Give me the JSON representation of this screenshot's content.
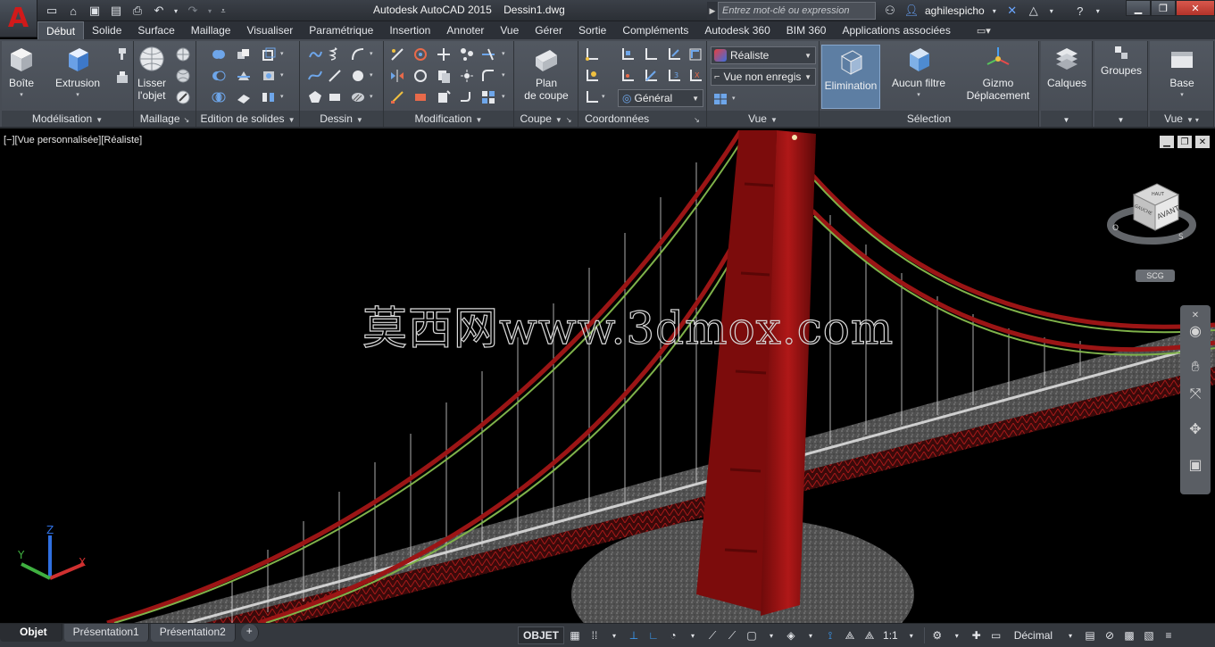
{
  "titlebar": {
    "app_name": "Autodesk AutoCAD 2015",
    "document_name": "Dessin1.dwg",
    "search_placeholder": "Entrez mot-clé ou expression",
    "username": "aghilespicho",
    "app_logo": "A"
  },
  "ribbon_tabs": [
    "Début",
    "Solide",
    "Surface",
    "Maillage",
    "Visualiser",
    "Paramétrique",
    "Insertion",
    "Annoter",
    "Vue",
    "Gérer",
    "Sortie",
    "Compléments",
    "Autodesk 360",
    "BIM 360",
    "Applications associées"
  ],
  "ribbon": {
    "modelisation": {
      "title": "Modélisation",
      "boite": "Boîte",
      "extrusion": "Extrusion"
    },
    "maillage": {
      "title": "Maillage",
      "lisser_1": "Lisser",
      "lisser_2": "l'objet"
    },
    "edition": {
      "title": "Edition de solides"
    },
    "dessin": {
      "title": "Dessin"
    },
    "modification": {
      "title": "Modification"
    },
    "coupe": {
      "title": "Coupe",
      "plan_1": "Plan",
      "plan_2": "de coupe"
    },
    "coordonnees": {
      "title": "Coordonnées",
      "ucs_value": "Général"
    },
    "vue": {
      "title": "Vue",
      "visual_style": "Réaliste",
      "named_view": "Vue non enregis"
    },
    "selection": {
      "title": "Sélection",
      "elimination": "Elimination",
      "filtre": "Aucun filtre",
      "gizmo_1": "Gizmo",
      "gizmo_2": "Déplacement"
    },
    "calques": {
      "title": "Calques"
    },
    "groupes": {
      "title": "Groupes"
    },
    "base": {
      "title": "Base"
    },
    "vue2": {
      "title": "Vue"
    }
  },
  "viewport": {
    "label": "[−][Vue personnalisée][Réaliste]",
    "watermark": "莫西网www.3dmox.com",
    "viewcube_face": "AVANT",
    "viewcube_top": "HAUT",
    "viewcube_side": "GAUCHE",
    "compass_s": "S",
    "compass_o": "O",
    "scg": "SCG",
    "ucs_x": "X",
    "ucs_y": "Y",
    "ucs_z": "Z"
  },
  "layout_tabs": [
    "Objet",
    "Présentation1",
    "Présentation2"
  ],
  "statusbar": {
    "objet": "OBJET",
    "scale": "1:1",
    "units": "Décimal"
  },
  "colors": {
    "tower": "#8f1010",
    "cable_green": "#7fb24a",
    "deck": "#5e5e5e",
    "accent_blue": "#3aa0ff"
  }
}
